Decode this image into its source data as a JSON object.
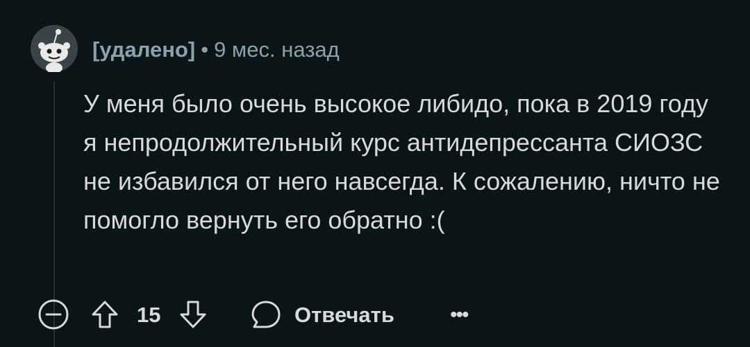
{
  "comment": {
    "author": "[удалено]",
    "separator": "•",
    "time": "9 мес. назад",
    "text": "У меня было очень высокое либидо, пока в 2019 году я непродолжительный курс антидепрессанта СИОЗС не избавился от него навсегда. К сожалению, ничто не помогло вернуть его обратно :(",
    "score": "15",
    "reply_label": "Отвечать",
    "more_label": "•••"
  },
  "icons": {
    "avatar": "reddit-snoo-avatar",
    "collapse": "minus-circle-icon",
    "upvote": "arrow-up-icon",
    "downvote": "arrow-down-icon",
    "reply": "speech-bubble-icon",
    "more": "ellipsis-icon"
  },
  "colors": {
    "background": "#0b1416",
    "text": "#d7dadc",
    "meta": "#8ba2ad",
    "thread_line": "#2a3236"
  }
}
